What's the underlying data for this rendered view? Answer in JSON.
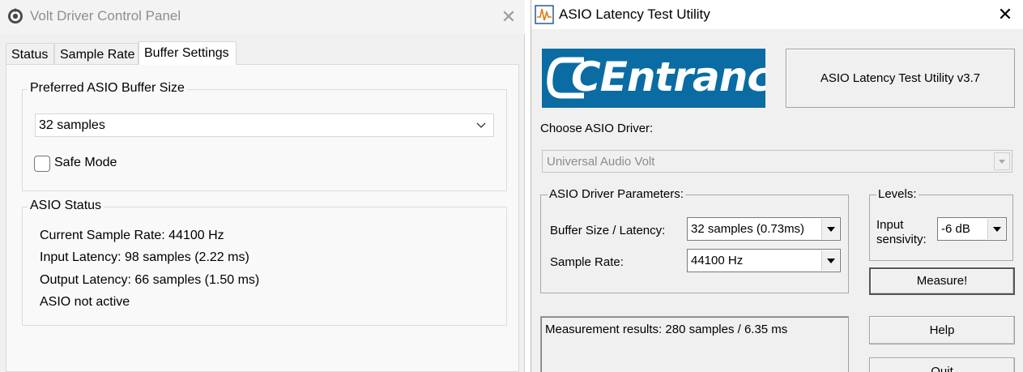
{
  "left_window": {
    "title": "Volt Driver Control Panel",
    "close_glyph": "✕",
    "icon": "speaker-gear-icon",
    "tabs": [
      "Status",
      "Sample Rate",
      "Buffer Settings"
    ],
    "active_tab": "Buffer Settings",
    "buffer_group": {
      "legend": "Preferred ASIO Buffer Size",
      "selected_size": "32 samples",
      "safe_mode_label": "Safe Mode",
      "safe_mode_checked": false
    },
    "status_group": {
      "legend": "ASIO Status",
      "lines": [
        "Current Sample Rate: 44100 Hz",
        "Input Latency: 98 samples (2.22 ms)",
        "Output Latency: 66 samples (1.50 ms)",
        "ASIO not active"
      ]
    }
  },
  "right_window": {
    "title": "ASIO Latency Test Utility",
    "close_glyph": "✕",
    "icon": "waveform-icon",
    "logo_text": "CEntrance",
    "logo_color": "#0a6ca2",
    "version": "ASIO Latency Test Utility v3.7",
    "driver_label": "Choose ASIO Driver:",
    "driver_value": "Universal Audio Volt",
    "driver_enabled": false,
    "params": {
      "legend": "ASIO Driver Parameters:",
      "buffer_label": "Buffer Size / Latency:",
      "buffer_value": "32 samples (0.73ms)",
      "sample_rate_label": "Sample Rate:",
      "sample_rate_value": "44100 Hz"
    },
    "levels": {
      "legend": "Levels:",
      "input_label_line1": "Input",
      "input_label_line2": "sensivity:",
      "input_value": "-6 dB"
    },
    "buttons": {
      "measure": "Measure!",
      "help": "Help",
      "quit": "Quit"
    },
    "results": "Measurement results: 280 samples / 6.35 ms"
  }
}
